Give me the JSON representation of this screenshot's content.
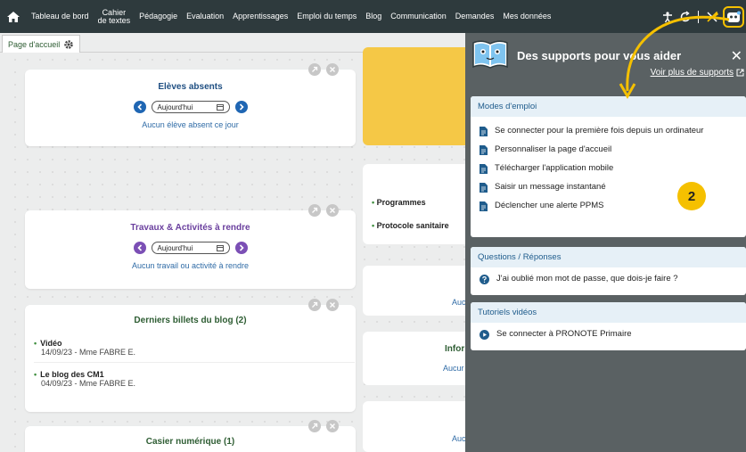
{
  "nav": {
    "items": [
      "Tableau de bord",
      "Pédagogie",
      "Evaluation",
      "Apprentissages",
      "Emploi du temps",
      "Blog",
      "Communication",
      "Demandes",
      "Mes données"
    ],
    "cahier_line1": "Cahier",
    "cahier_line2": "de textes"
  },
  "tab": {
    "label": "Page d'accueil"
  },
  "dashboard": {
    "absent": {
      "title": "Elèves absents",
      "date": "Aujourd'hui",
      "empty": "Aucun élève absent ce jour"
    },
    "travaux": {
      "title": "Travaux & Activités à rendre",
      "date": "Aujourd'hui",
      "empty": "Aucun travail ou activité à rendre"
    },
    "blog": {
      "title": "Derniers billets du blog (2)",
      "posts": [
        {
          "title": "Vidéo",
          "meta": "14/09/23 - Mme FABRE E."
        },
        {
          "title": "Le blog des CM1",
          "meta": "04/09/23 - Mme FABRE E."
        }
      ]
    },
    "casier": {
      "title": "Casier numérique (1)"
    },
    "right": {
      "links": [
        "Programmes",
        "Protocole sanitaire"
      ],
      "trunc1": "Auc",
      "info": "Infor",
      "trunc2": "Aucur",
      "trunc3": "Auc"
    }
  },
  "panel": {
    "title": "Des supports pour vous aider",
    "link": "Voir plus de supports",
    "badge": "2",
    "sections": {
      "modes": {
        "title": "Modes d'emploi",
        "items": [
          "Se connecter pour la première fois depuis un ordinateur",
          "Personnaliser la page d'accueil",
          "Télécharger l'application mobile",
          "Saisir un message instantané",
          "Déclencher une alerte PPMS"
        ]
      },
      "qa": {
        "title": "Questions / Réponses",
        "items": [
          "J'ai oublié mon mot de passe, que dois-je faire ?"
        ]
      },
      "videos": {
        "title": "Tutoriels vidéos",
        "items": [
          "Se connecter à PRONOTE Primaire"
        ]
      }
    }
  },
  "colors": {
    "accent_green": "#2e5d33",
    "nav_dark": "#2e3a3d",
    "blue_arrow": "#1f66b3",
    "purple_arrow": "#7b4fb5",
    "yellow": "#f5c000",
    "panel_bg": "#5a6163"
  }
}
